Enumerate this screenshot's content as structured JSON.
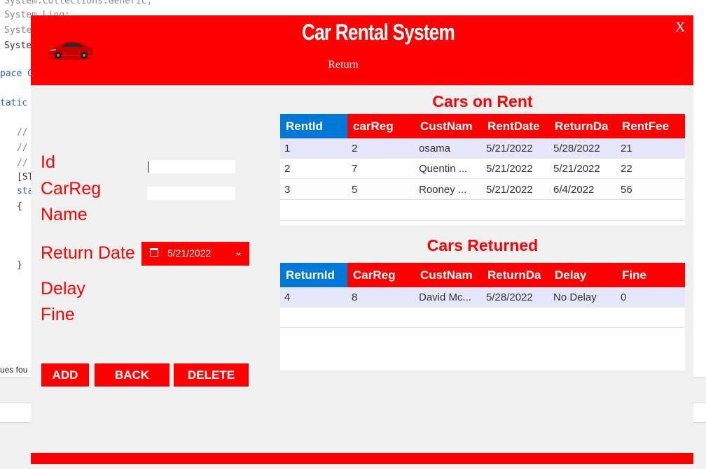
{
  "ide": {
    "lines": [
      "System.Collections.Generic;",
      "System.Linq;",
      "Syste",
      "Syste",
      "pace C",
      "tatic",
      "//",
      "//",
      "//",
      "[ST",
      "sta",
      "{",
      "}"
    ],
    "status": "ues fou"
  },
  "app": {
    "title": "Car Rental System",
    "subtitle": "Return",
    "close_label": "X",
    "form": {
      "id_label": "Id",
      "carreg_label": "CarReg",
      "name_label": "Name",
      "return_date_label": "Return Date",
      "delay_label": "Delay",
      "fine_label": "Fine",
      "return_date_value": "5/21/2022"
    },
    "buttons": {
      "add": "ADD",
      "back": "BACK",
      "delete": "DELETE"
    },
    "cars_on_rent": {
      "title": "Cars on Rent",
      "columns": [
        "RentId",
        "carReg",
        "CustNam",
        "RentDate",
        "ReturnDa",
        "RentFee"
      ],
      "rows": [
        [
          "1",
          "2",
          "osama",
          "5/21/2022",
          "5/28/2022",
          "21"
        ],
        [
          "2",
          "7",
          "Quentin ...",
          "5/21/2022",
          "5/21/2022",
          "22"
        ],
        [
          "3",
          "5",
          "Rooney ...",
          "5/21/2022",
          "6/4/2022",
          "56"
        ]
      ]
    },
    "cars_returned": {
      "title": "Cars Returned",
      "columns": [
        "ReturnId",
        "CarReg",
        "CustNam",
        "ReturnDa",
        "Delay",
        "Fine"
      ],
      "rows": [
        [
          "4",
          "8",
          "David Mc...",
          "5/28/2022",
          "No Delay",
          "0"
        ]
      ]
    }
  },
  "colors": {
    "brand": "#ff0000",
    "header_first_col": "#0078d7",
    "row_alt": "#e6e6fa",
    "panel_bg": "#f0f0f0"
  }
}
